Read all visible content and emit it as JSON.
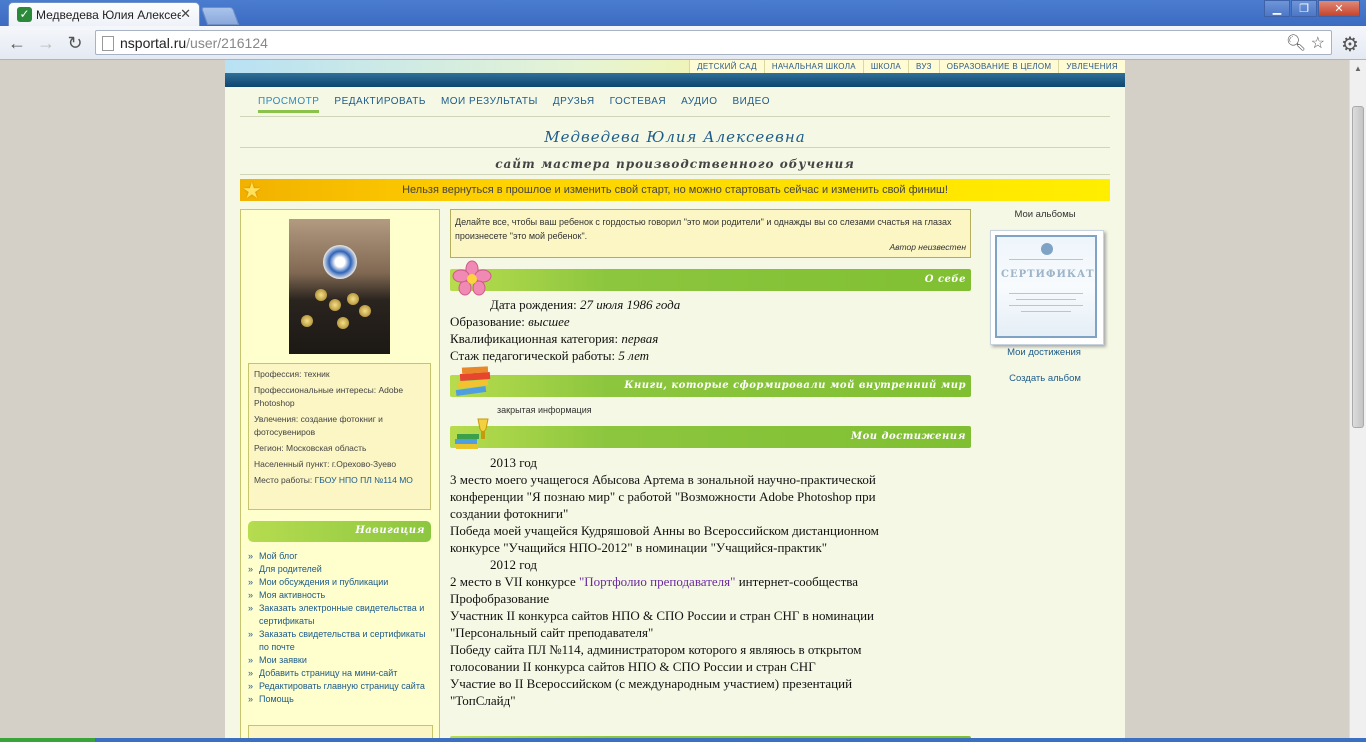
{
  "browser": {
    "tab_title": "Медведева Юлия Алексее",
    "tab_close": "✕",
    "url_host": "nsportal.ru",
    "url_path": "/user/216124"
  },
  "site": {
    "categories": [
      "ДЕТСКИЙ САД",
      "НАЧАЛЬНАЯ ШКОЛА",
      "ШКОЛА",
      "ВУЗ",
      "ОБРАЗОВАНИЕ В ЦЕЛОМ",
      "УВЛЕЧЕНИЯ"
    ],
    "nav": [
      "ПРОСМОТР",
      "РЕДАКТИРОВАТЬ",
      "МОИ РЕЗУЛЬТАТЫ",
      "ДРУЗЬЯ",
      "ГОСТЕВАЯ",
      "АУДИО",
      "ВИДЕО"
    ],
    "nav_active": "ПРОСМОТР",
    "user_name": "Медведева Юлия Алексеевна",
    "subtitle": "сайт мастера производственного обучения",
    "motto": "Нельзя вернуться в прошлое и изменить свой старт, но можно стартовать сейчас и изменить свой финиш!"
  },
  "profile": {
    "profession": "Профессия: техник",
    "interests": "Профессиональные интересы: Adobe Photoshop",
    "hobbies": "Увлечения: создание фотокниг и фотосувениров",
    "region": "Регион: Московская область",
    "locality": "Населенный пункт: г.Орехово-Зуево",
    "work_label": "Место работы: ",
    "work_link": "ГБОУ НПО ПЛ №114 МО"
  },
  "navigation": {
    "title": "Навигация",
    "links": [
      "Мой блог",
      "Для родителей",
      "Мои обсуждения и публикации",
      "Моя активность",
      "Заказать электронные свидетельства и сертификаты",
      "Заказать свидетельства и сертификаты по почте",
      "Мои заявки",
      "Добавить страницу на мини-сайт",
      "Редактировать главную страницу сайта",
      "Помощь"
    ]
  },
  "quote": {
    "text": "Делайте все, чтобы ваш ребенок с гордостью говорил \"это мои родители\" и однажды вы со слезами счастья на глазах произнесете \"это мой ребенок\".",
    "author": "Автор неизвестен"
  },
  "about": {
    "title": "О себе",
    "birth_label": "Дата рождения: ",
    "birth_value": "27 июля 1986 года",
    "education_label": "Образование: ",
    "education_value": "высшее",
    "category_label": "Квалификационная категория: ",
    "category_value": "первая",
    "experience_label": "Стаж педагогической работы: ",
    "experience_value": "5 лет"
  },
  "books": {
    "title": "Книги, которые сформировали мой внутренний мир",
    "note": "закрытая информация"
  },
  "achievements": {
    "title": "Мои достижения",
    "year_2013": "2013 год",
    "a1": [
      "3 место моего учащегося Абысова Артема в зональной научно-практической",
      "конференции \"Я познаю мир\" с работой \"Возможности Adobe Photoshop при",
      "создании фотокниги\""
    ],
    "a2": [
      "Победа моей учащейся Кудряшовой Анны во Всероссийском дистанционном",
      "конкурсе \"Учащийся НПО-2012\" в номинации \"Учащийся-практик\""
    ],
    "year_2012": "2012 год",
    "a3_before": "2 место в VII конкурсе ",
    "a3_link": "\"Портфолио преподавателя\"",
    "a3_after": " интернет-сообщества",
    "a3_line2": "Профобразование",
    "a4": [
      "Участник II конкурса сайтов НПО & СПО России и стран СНГ в номинации",
      "\"Персональный сайт преподавателя\""
    ],
    "a5": [
      "Победу сайта ПЛ №114, администратором которого я являюсь в открытом",
      "голосовании II конкурса сайтов НПО & СПО России и стран СНГ"
    ],
    "a6": [
      "Участие во II Всероссийском (с международным участием) презентаций",
      "\"ТопСлайд\""
    ]
  },
  "albums": {
    "title": "Мои альбомы",
    "cert_word": "СЕРТИФИКАТ",
    "album_name": "Мои достижения",
    "create": "Создать альбом"
  },
  "icons": {
    "tab_favicon": "check-icon",
    "back": "back-arrow-icon",
    "forward": "forward-arrow-icon",
    "reload": "reload-icon",
    "zoom": "zoom-icon",
    "bookmark": "star-icon",
    "menu": "wrench-icon"
  }
}
